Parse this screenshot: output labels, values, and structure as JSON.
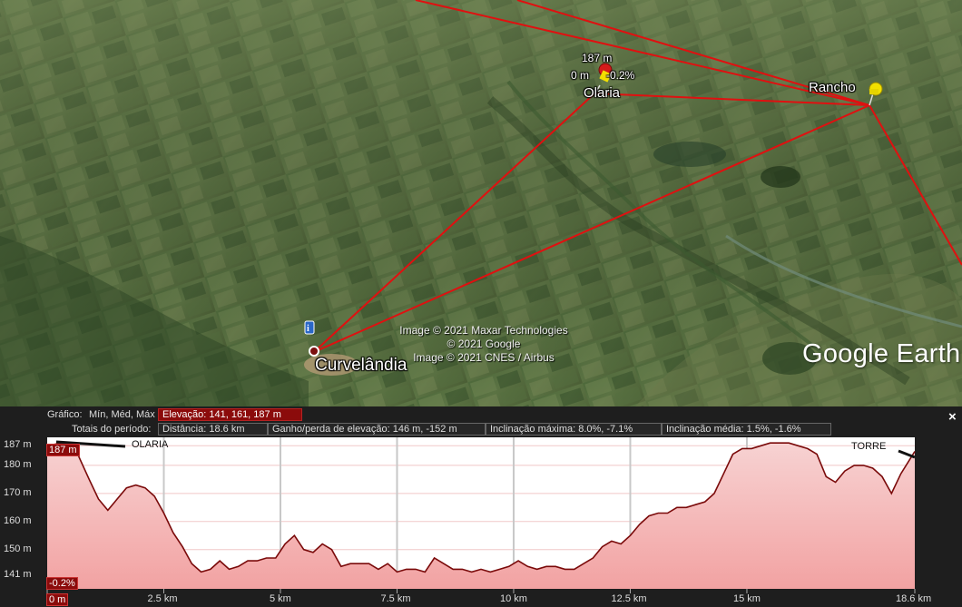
{
  "map": {
    "places": {
      "olaria": "Olaria",
      "rancho": "Rancho",
      "curvelandia": "Curvelândia"
    },
    "pin_elevation": "187 m",
    "pin_distance": "0 m",
    "pin_slope": "-0.2%",
    "credits": [
      "Image © 2021 Maxar Technologies",
      "© 2021 Google",
      "Image © 2021 CNES / Airbus"
    ],
    "brand": "Google Earth",
    "colors": {
      "path": "#e01010",
      "pin": "#f2e000",
      "pin_red": "#d41b1b"
    }
  },
  "profile": {
    "graph_label": "Gráfico:",
    "graph_options": "Mín, Méd, Máx",
    "elevation_label": "Elevação: 141, 161, 187 m",
    "totals_label": "Totais do período:",
    "distance": "Distância: 18.6 km",
    "gain_loss": "Ganho/perda de elevação: 146 m, -152 m",
    "max_slope": "Inclinação máxima: 8.0%, -7.1%",
    "avg_slope": "Inclinação média: 1.5%, -1.6%",
    "close": "×",
    "annotations": {
      "start": "OLARIA",
      "end": "TORRE"
    },
    "cursor_elevation": "187 m",
    "cursor_slope": "-0.2%",
    "cursor_distance": "0 m"
  },
  "chart_data": {
    "type": "area",
    "title": "",
    "xlabel": "",
    "ylabel": "",
    "x_unit": "km",
    "y_unit": "m",
    "xlim": [
      0,
      18.6
    ],
    "ylim": [
      136,
      190
    ],
    "y_ticks": [
      {
        "value": 187,
        "label": "187 m"
      },
      {
        "value": 180,
        "label": "180 m"
      },
      {
        "value": 170,
        "label": "170 m"
      },
      {
        "value": 160,
        "label": "160 m"
      },
      {
        "value": 150,
        "label": "150 m"
      },
      {
        "value": 141,
        "label": "141 m"
      }
    ],
    "x_ticks": [
      {
        "value": 0,
        "label": "0 m"
      },
      {
        "value": 2.5,
        "label": "2.5 km"
      },
      {
        "value": 5,
        "label": "5 km"
      },
      {
        "value": 7.5,
        "label": "7.5 km"
      },
      {
        "value": 10,
        "label": "10 km"
      },
      {
        "value": 12.5,
        "label": "12.5 km"
      },
      {
        "value": 15,
        "label": "15 km"
      },
      {
        "value": 18.6,
        "label": "18.6 km"
      }
    ],
    "colors": {
      "line": "#7a0a0a",
      "fill_top": "#f7d2d2",
      "fill_bottom": "#f2a2a2"
    },
    "series": [
      {
        "x": [
          0,
          0.3,
          0.6,
          0.9,
          1.1,
          1.3,
          1.5,
          1.7,
          1.9,
          2.1,
          2.3,
          2.5,
          2.7,
          2.9,
          3.1,
          3.3,
          3.5,
          3.7,
          3.9,
          4.1,
          4.3,
          4.5,
          4.7,
          4.9,
          5.1,
          5.3,
          5.5,
          5.7,
          5.9,
          6.1,
          6.3,
          6.5,
          6.7,
          6.9,
          7.1,
          7.3,
          7.5,
          7.7,
          7.9,
          8.1,
          8.3,
          8.5,
          8.7,
          8.9,
          9.1,
          9.3,
          9.5,
          9.7,
          9.9,
          10.1,
          10.3,
          10.5,
          10.7,
          10.9,
          11.1,
          11.3,
          11.5,
          11.7,
          11.9,
          12.1,
          12.3,
          12.5,
          12.7,
          12.9,
          13.1,
          13.3,
          13.5,
          13.7,
          13.9,
          14.1,
          14.3,
          14.5,
          14.7,
          14.9,
          15.1,
          15.3,
          15.5,
          15.7,
          15.9,
          16.1,
          16.3,
          16.5,
          16.7,
          16.9,
          17.1,
          17.3,
          17.5,
          17.7,
          17.9,
          18.1,
          18.3,
          18.6
        ],
        "y": [
          187,
          188,
          186,
          175,
          168,
          164,
          168,
          172,
          173,
          172,
          169,
          163,
          156,
          151,
          145,
          142,
          143,
          146,
          143,
          144,
          146,
          146,
          147,
          147,
          152,
          155,
          150,
          149,
          152,
          150,
          144,
          145,
          145,
          145,
          143,
          145,
          142,
          143,
          143,
          142,
          147,
          145,
          143,
          143,
          142,
          143,
          142,
          143,
          144,
          146,
          144,
          143,
          144,
          144,
          143,
          143,
          145,
          147,
          151,
          153,
          152,
          155,
          159,
          162,
          163,
          163,
          165,
          165,
          166,
          167,
          170,
          177,
          184,
          186,
          186,
          187,
          188,
          188,
          188,
          187,
          186,
          184,
          176,
          174,
          178,
          180,
          180,
          179,
          176,
          170,
          177,
          185
        ]
      }
    ]
  }
}
